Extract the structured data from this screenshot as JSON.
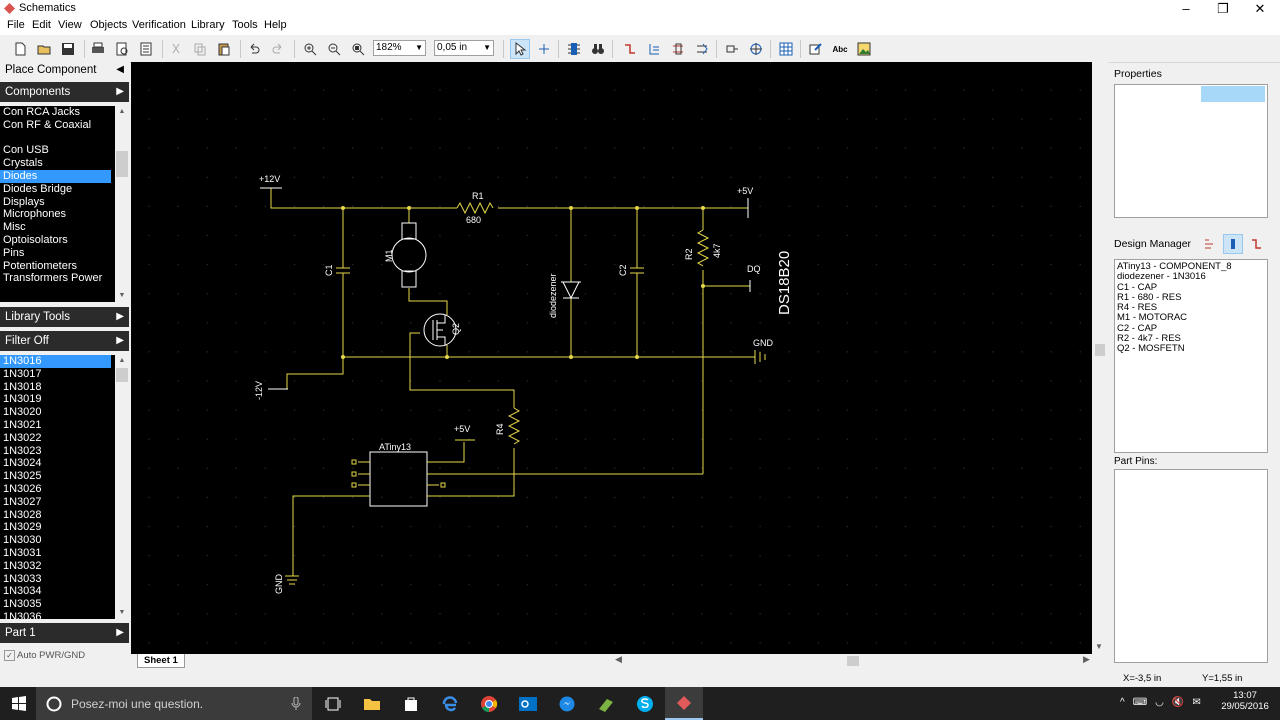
{
  "window": {
    "title": "Schematics"
  },
  "menu": [
    "File",
    "Edit",
    "View",
    "Objects",
    "Verification",
    "Library",
    "Tools",
    "Help"
  ],
  "toolbar": {
    "zoom": "182%",
    "grid": "0,05 in"
  },
  "left": {
    "place_component": "Place Component",
    "components": "Components",
    "categories": [
      "Con RCA Jacks",
      "Con RF & Coaxial",
      "",
      "Con USB",
      "Crystals",
      "Diodes",
      "Diodes Bridge",
      "Displays",
      "Microphones",
      "Misc",
      "Optoisolators",
      "Pins",
      "Potentiometers",
      "Transformers Power"
    ],
    "selected_category": "Diodes",
    "library_tools": "Library Tools",
    "filter": "Filter Off",
    "parts": [
      "1N3016",
      "1N3017",
      "1N3018",
      "1N3019",
      "1N3020",
      "1N3021",
      "1N3022",
      "1N3023",
      "1N3024",
      "1N3025",
      "1N3026",
      "1N3027",
      "1N3028",
      "1N3029",
      "1N3030",
      "1N3031",
      "1N3032",
      "1N3033",
      "1N3034",
      "1N3035",
      "1N3036"
    ],
    "selected_part": "1N3016",
    "part_header": "Part 1",
    "auto_pwr": "Auto PWR/GND"
  },
  "schematic": {
    "labels": {
      "vcc12": "+12V",
      "vcc5a": "+5V",
      "vcc5b": "+5V",
      "vneg12": "-12V",
      "gnd1": "GND",
      "gnd2": "GND",
      "r1": "R1",
      "r1v": "680",
      "r2": "R2",
      "r2v": "4k7",
      "r4": "R4",
      "c1": "C1",
      "c2": "C2",
      "m1": "M1",
      "q2": "Q2",
      "dz": "diodezener",
      "dq": "DQ",
      "ds": "DS18B20",
      "atiny": "ATiny13"
    },
    "sheet_tab": "Sheet 1"
  },
  "right": {
    "properties": "Properties",
    "design_manager": "Design Manager",
    "dm_items": [
      "ATiny13 - COMPONENT_8",
      "diodezener - 1N3016",
      "C1 - CAP",
      "R1 - 680 - RES",
      "R4 - RES",
      "M1 - MOTORAC",
      "C2 - CAP",
      "R2 - 4k7 - RES",
      "Q2 - MOSFETN"
    ],
    "part_pins": "Part Pins:"
  },
  "status": {
    "x": "X=-3,5 in",
    "y": "Y=1,55 in"
  },
  "taskbar": {
    "search": "Posez-moi une question.",
    "time": "13:07",
    "date": "29/05/2016"
  }
}
